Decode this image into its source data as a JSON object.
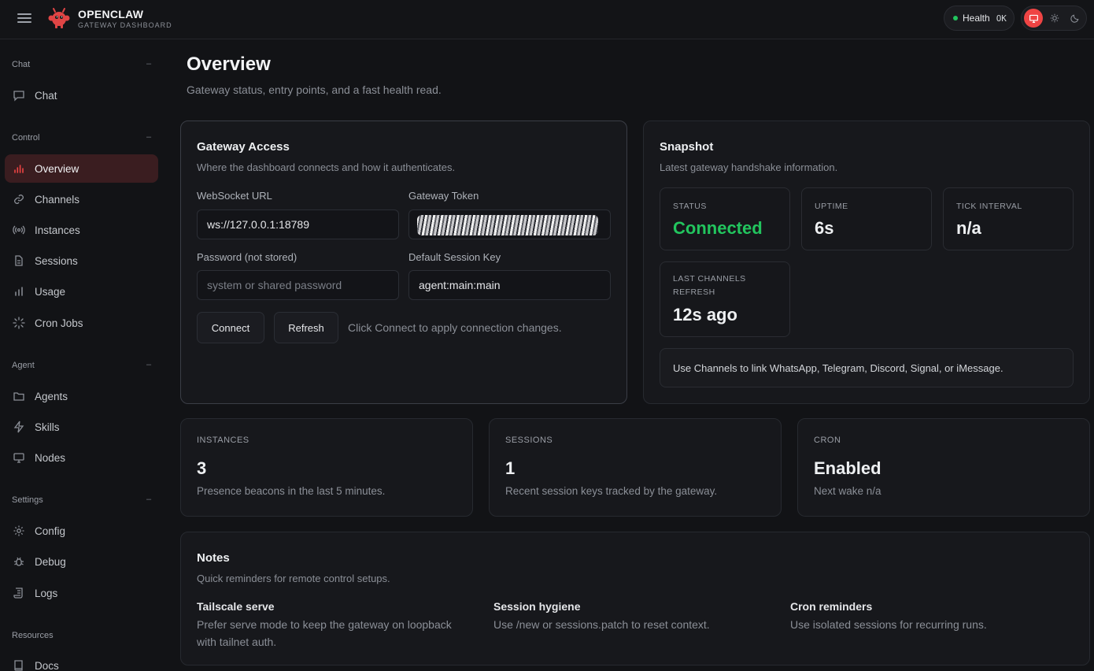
{
  "app": {
    "brand_title": "OPENCLAW",
    "brand_subtitle": "GATEWAY DASHBOARD",
    "health_label": "Health",
    "health_value": "OK",
    "accent_color": "#ef4444",
    "health_color": "#22c55e"
  },
  "sidebar": {
    "groups": [
      {
        "title": "Chat",
        "items": [
          {
            "label": "Chat",
            "icon": "message-icon"
          }
        ]
      },
      {
        "title": "Control",
        "items": [
          {
            "label": "Overview",
            "icon": "bar-chart-icon",
            "active": true
          },
          {
            "label": "Channels",
            "icon": "link-icon"
          },
          {
            "label": "Instances",
            "icon": "radio-icon"
          },
          {
            "label": "Sessions",
            "icon": "file-icon"
          },
          {
            "label": "Usage",
            "icon": "bar-chart-icon"
          },
          {
            "label": "Cron Jobs",
            "icon": "loader-icon"
          }
        ]
      },
      {
        "title": "Agent",
        "items": [
          {
            "label": "Agents",
            "icon": "folder-icon"
          },
          {
            "label": "Skills",
            "icon": "zap-icon"
          },
          {
            "label": "Nodes",
            "icon": "monitor-icon"
          }
        ]
      },
      {
        "title": "Settings",
        "items": [
          {
            "label": "Config",
            "icon": "gear-icon"
          },
          {
            "label": "Debug",
            "icon": "bug-icon"
          },
          {
            "label": "Logs",
            "icon": "scroll-icon"
          }
        ]
      },
      {
        "title": "Resources",
        "items": [
          {
            "label": "Docs",
            "icon": "book-icon"
          }
        ]
      }
    ],
    "collapse_symbol": "–"
  },
  "page": {
    "title": "Overview",
    "subtitle": "Gateway status, entry points, and a fast health read."
  },
  "gateway_access": {
    "title": "Gateway Access",
    "subtitle": "Where the dashboard connects and how it authenticates.",
    "ws_label": "WebSocket URL",
    "ws_value": "ws://127.0.0.1:18789",
    "token_label": "Gateway Token",
    "password_label": "Password (not stored)",
    "password_placeholder": "system or shared password",
    "session_key_label": "Default Session Key",
    "session_key_value": "agent:main:main",
    "connect_label": "Connect",
    "refresh_label": "Refresh",
    "hint": "Click Connect to apply connection changes."
  },
  "snapshot": {
    "title": "Snapshot",
    "subtitle": "Latest gateway handshake information.",
    "status_label": "STATUS",
    "status_value": "Connected",
    "uptime_label": "UPTIME",
    "uptime_value": "6s",
    "tick_label": "TICK INTERVAL",
    "tick_value": "n/a",
    "last_refresh_label_1": "LAST CHANNELS",
    "last_refresh_label_2": "REFRESH",
    "last_refresh_value": "12s ago",
    "callout": "Use Channels to link WhatsApp, Telegram, Discord, Signal, or iMessage."
  },
  "metrics": [
    {
      "label": "INSTANCES",
      "value": "3",
      "sub": "Presence beacons in the last 5 minutes."
    },
    {
      "label": "SESSIONS",
      "value": "1",
      "sub": "Recent session keys tracked by the gateway."
    },
    {
      "label": "CRON",
      "value": "Enabled",
      "sub": "Next wake n/a"
    }
  ],
  "notes": {
    "title": "Notes",
    "subtitle": "Quick reminders for remote control setups.",
    "items": [
      {
        "title": "Tailscale serve",
        "text": "Prefer serve mode to keep the gateway on loopback with tailnet auth."
      },
      {
        "title": "Session hygiene",
        "text": "Use /new or sessions.patch to reset context."
      },
      {
        "title": "Cron reminders",
        "text": "Use isolated sessions for recurring runs."
      }
    ]
  }
}
